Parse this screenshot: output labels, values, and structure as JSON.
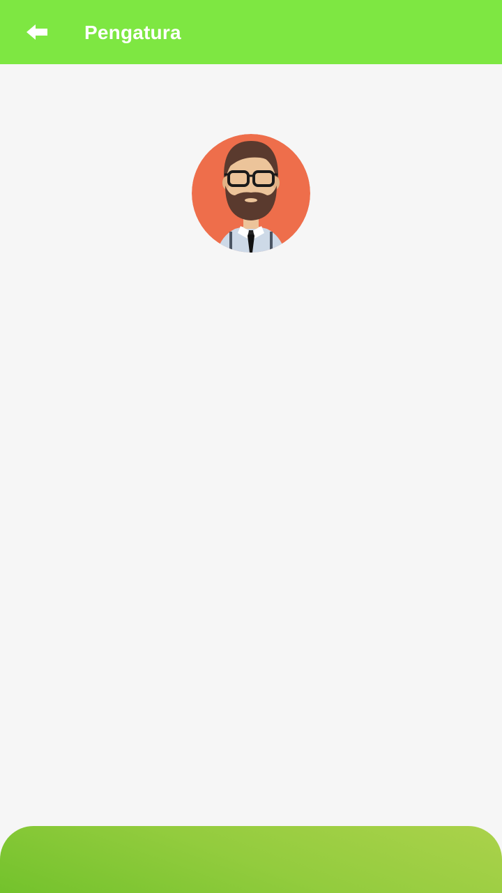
{
  "app_bar": {
    "title": "Pengatura",
    "back_icon": "arrow-left-icon",
    "background_color": "#7ee742",
    "text_color": "#ffffff"
  },
  "profile": {
    "avatar_icon": "avatar-man-beard-glasses",
    "avatar_background_color": "#ee6e4b"
  },
  "page": {
    "background_color": "#f6f6f6"
  },
  "bottom_panel": {
    "gradient_start": "#73c22c",
    "gradient_end": "#abd24b"
  }
}
